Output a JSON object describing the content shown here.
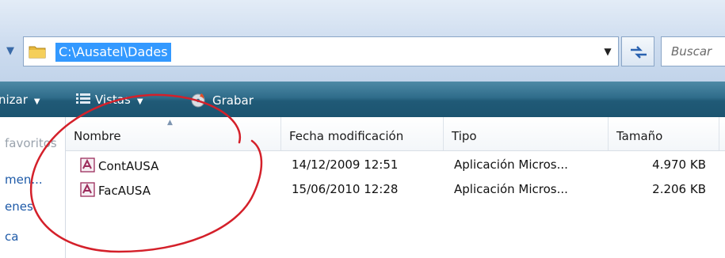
{
  "address_bar": {
    "path": "C:\\Ausatel\\Dades",
    "search_placeholder": "Buscar"
  },
  "toolbar": {
    "organize_label": "nizar",
    "views_label": "Vistas",
    "burn_label": "Grabar"
  },
  "nav_pane": {
    "items": [
      "favoritos",
      "men...",
      "enes",
      "ca"
    ]
  },
  "file_list": {
    "columns": [
      "Nombre",
      "Fecha modificación",
      "Tipo",
      "Tamaño"
    ],
    "sort_column": "Nombre",
    "rows": [
      {
        "name": "ContAUSA",
        "date": "14/12/2009 12:51",
        "type": "Aplicación Micros...",
        "size": "4.970 KB"
      },
      {
        "name": "FacAUSA",
        "date": "15/06/2010 12:28",
        "type": "Aplicación Micros...",
        "size": "2.206 KB"
      }
    ]
  },
  "icons": {
    "address_folder": "folder-icon",
    "refresh": "refresh-icon",
    "views": "views-icon",
    "burn": "burn-disc-icon",
    "file": "access-file-icon"
  },
  "colors": {
    "selection": "#3399ff",
    "toolbar": "#2f6c8a",
    "annotation": "#d4202a",
    "nav_link": "#1e5aa8"
  }
}
